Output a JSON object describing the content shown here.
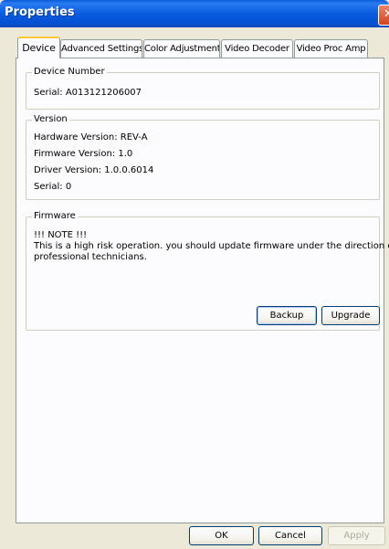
{
  "window": {
    "title": "Properties",
    "close_glyph": "✕",
    "close_icon": "close-icon"
  },
  "tabs": [
    {
      "label": "Device",
      "active": true
    },
    {
      "label": "Advanced Settings",
      "active": false
    },
    {
      "label": "Color Adjustment",
      "active": false
    },
    {
      "label": "Video Decoder",
      "active": false
    },
    {
      "label": "Video Proc Amp",
      "active": false
    }
  ],
  "device_number": {
    "legend": "Device Number",
    "serial": "Serial: A013121206007"
  },
  "version": {
    "legend": "Version",
    "hardware": "Hardware Version: REV-A",
    "firmware": "Firmware Version: 1.0",
    "driver": "Driver Version: 1.0.0.6014",
    "serial": "Serial: 0"
  },
  "firmware": {
    "legend": "Firmware",
    "note": "!!! NOTE !!!",
    "warning_line1": "This is a high risk operation. you should update firmware under the direction of",
    "warning_line2": "professional technicians.",
    "backup_label": "Backup",
    "upgrade_label": "Upgrade"
  },
  "footer": {
    "ok_label": "OK",
    "cancel_label": "Cancel",
    "apply_label": "Apply",
    "apply_enabled": false
  },
  "colors": {
    "titlebar": "#0a5be0",
    "dialog_bg": "#ece9d8",
    "panel_bg": "#fcfcfe",
    "active_tab_accent": "#ffc73c"
  }
}
